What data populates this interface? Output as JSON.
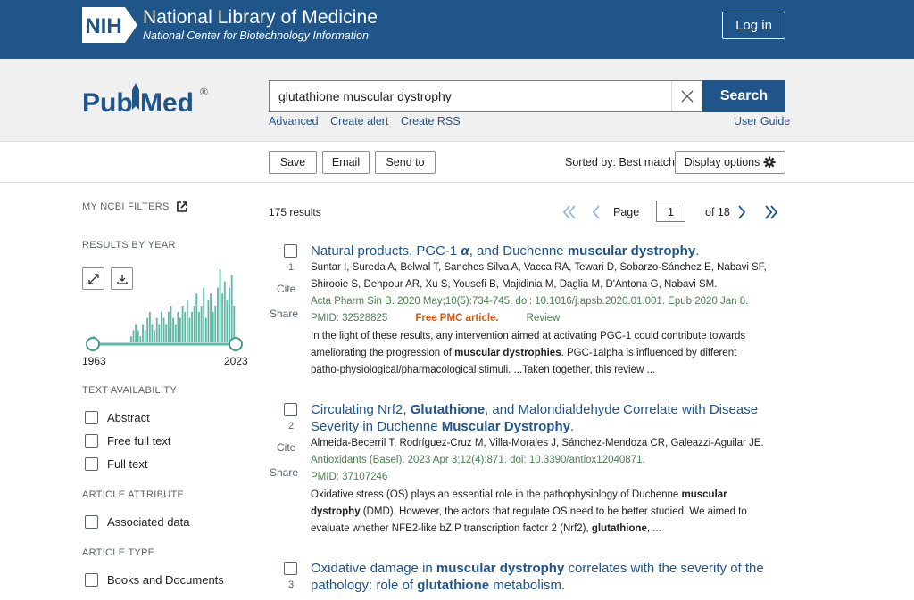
{
  "header": {
    "nih_badge": "NIH",
    "title": "National Library of Medicine",
    "subtitle": "National Center for Biotechnology Information",
    "login_label": "Log in"
  },
  "logo": {
    "name": "PubMed",
    "part1": "Pub",
    "part2": "Med",
    "registered": "®"
  },
  "search": {
    "query": "glutathione muscular dystrophy",
    "button_label": "Search",
    "links": {
      "advanced": "Advanced",
      "create_alert": "Create alert",
      "create_rss": "Create RSS"
    },
    "user_guide": "User Guide"
  },
  "actions": {
    "save": "Save",
    "email": "Email",
    "send_to": "Send to",
    "sorted_by": "Sorted by: Best match",
    "display_options": "Display options"
  },
  "sidebar": {
    "my_ncbi_filters": "MY NCBI FILTERS",
    "results_by_year": "RESULTS BY YEAR",
    "year_start": "1963",
    "year_end": "2023",
    "text_availability": "TEXT AVAILABILITY",
    "text_options": [
      "Abstract",
      "Free full text",
      "Full text"
    ],
    "article_attribute": "ARTICLE ATTRIBUTE",
    "attribute_options": [
      "Associated data"
    ],
    "article_type": "ARTICLE TYPE",
    "type_options": [
      "Books and Documents"
    ]
  },
  "results": {
    "count": "175 results",
    "page_label": "Page",
    "page_value": "1",
    "page_of": "of 18",
    "items": [
      {
        "number": "1",
        "cite": "Cite",
        "share": "Share",
        "title_a": "Natural products, PGC-1",
        "title_alpha": "α",
        "title_b": ", and Duchenne ",
        "title_c": "muscular dystrophy",
        "title_d": ".",
        "authors_1": "Suntar I, Sureda A, Belwal T, Sanches Silva A, Vacca RA, Tewari D, Sobarzo-Sánchez E, Nabavi SF,",
        "authors_2": "Shirooie S, Dehpour AR, Xu S, Yousefi B, Majidinia M, Daglia M, D'Antona G, Nabavi SM.",
        "citation": "Acta Pharm Sin B. 2020 May;10(5):734-745. doi: 10.1016/j.apsb.2020.01.001. Epub 2020 Jan 8.",
        "pmid": "PMID: 32528825",
        "free_pmc": "Free PMC article.",
        "review": "Review.",
        "snip1": "In the light of these results, any intervention aimed at activating PGC-1 could contribute towards",
        "snip2a": "ameliorating the progression of ",
        "snip2b": "muscular dystrophies",
        "snip2c": ". PGC-1alpha is influenced by different",
        "snip3": "patho-physiological/pharmacological stimuli. ...Taken together, this review ..."
      },
      {
        "number": "2",
        "cite": "Cite",
        "share": "Share",
        "title_a": "Circulating Nrf2, ",
        "title_b": "Glutathione",
        "title_c": ", and Malondialdehyde Correlate with Disease",
        "title_d": "Severity in Duchenne ",
        "title_e": "Muscular Dystrophy",
        "title_f": ".",
        "authors_1": "Almeida-Becerril T, Rodríguez-Cruz M, Villa-Morales J, Sánchez-Mendoza CR, Galeazzi-Aguilar JE.",
        "citation": "Antioxidants (Basel). 2023 Apr 3;12(4):871. doi: 10.3390/antiox12040871.",
        "pmid": "PMID: 37107246",
        "snip1a": "Oxidative stress (OS) plays an essential role in the pathophysiology of Duchenne ",
        "snip1b": "muscular",
        "snip2a": "dystrophy",
        "snip2b": " (DMD). However, the actors that regulate OS need to be better studied. We aimed to",
        "snip3a": "evaluate whether NFE2-like bZIP transcription factor 2 (Nrf2), ",
        "snip3b": "glutathione",
        "snip3c": ", ..."
      },
      {
        "number": "3",
        "title_a": "Oxidative damage in ",
        "title_b": "muscular dystrophy",
        "title_c": " correlates with the severity of the",
        "title_d": "pathology: role of ",
        "title_e": "glutathione",
        "title_f": " metabolism."
      }
    ]
  },
  "colors": {
    "nih_blue": "#20558a",
    "link_blue": "#20558a",
    "citation_green": "#4b7f52",
    "free_pmc_orange": "#cd5b1b",
    "histogram_teal": "#5cb8a5"
  },
  "histogram": {
    "counts": [
      1,
      0,
      0,
      0,
      0,
      0,
      0,
      0,
      0,
      0,
      0,
      0,
      0,
      0,
      0,
      0,
      1,
      2,
      3,
      2,
      1,
      3,
      2,
      4,
      5,
      3,
      2,
      4,
      3,
      5,
      4,
      3,
      5,
      6,
      4,
      3,
      5,
      4,
      6,
      5,
      7,
      4,
      5,
      6,
      8,
      5,
      6,
      9,
      4,
      7,
      8,
      5,
      6,
      9,
      12,
      8,
      10,
      7,
      9,
      11,
      6
    ]
  }
}
